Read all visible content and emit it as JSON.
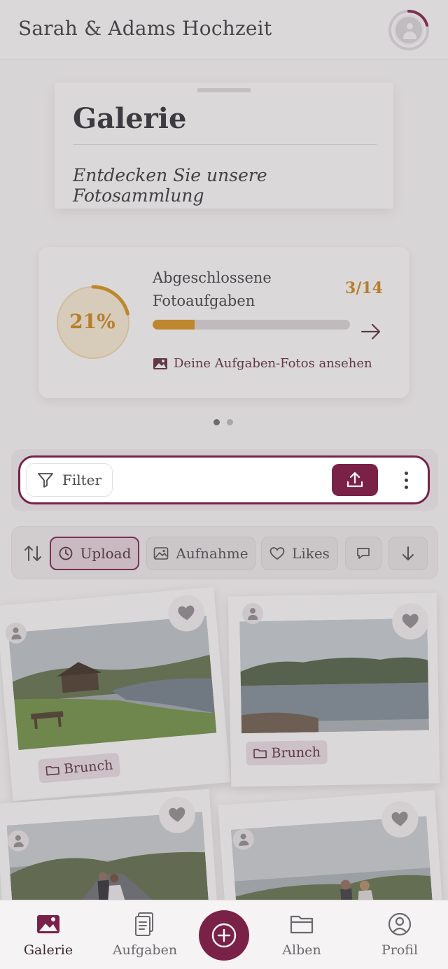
{
  "header": {
    "title": "Sarah & Adams Hochzeit",
    "profile_icon": "user-avatar-icon"
  },
  "intro": {
    "title": "Galerie",
    "subtitle": "Entdecken Sie unsere Fotosammlung"
  },
  "tasks": {
    "percent_label": "21%",
    "percent": 21,
    "label": "Abgeschlossene Fotoaufgaben",
    "count": "3/14",
    "completed": 3,
    "total": 14,
    "link_label": "Deine Aufgaben-Fotos ansehen"
  },
  "carousel": {
    "pages": 2,
    "active": 0
  },
  "toolbar": {
    "filter_label": "Filter",
    "upload_icon": "upload-icon",
    "more_icon": "more-vertical-icon"
  },
  "sort": {
    "chips": [
      {
        "label": "Upload",
        "icon": "clock-icon",
        "active": true
      },
      {
        "label": "Aufnahme",
        "icon": "image-icon",
        "active": false
      },
      {
        "label": "Likes",
        "icon": "heart-icon",
        "active": false
      },
      {
        "label": "",
        "icon": "comment-icon",
        "active": false
      },
      {
        "label": "",
        "icon": "arrow-down-icon",
        "active": false
      }
    ]
  },
  "photos": [
    {
      "album": "Brunch",
      "scene": "lake-cabin"
    },
    {
      "album": "Brunch",
      "scene": "lake-mountains"
    },
    {
      "album": "",
      "scene": "couple-road"
    },
    {
      "album": "",
      "scene": "couple-field"
    }
  ],
  "nav": {
    "items": [
      {
        "label": "Galerie",
        "icon": "gallery-icon",
        "active": true
      },
      {
        "label": "Aufgaben",
        "icon": "tasks-icon",
        "active": false
      },
      {
        "label": "Alben",
        "icon": "folder-icon",
        "active": false
      },
      {
        "label": "Profil",
        "icon": "profile-icon",
        "active": false
      }
    ],
    "fab_icon": "plus-circle-icon"
  },
  "colors": {
    "brand": "#7a2148",
    "accent": "#d38f1c",
    "overlay": "rgba(120,110,115,0.22)"
  }
}
